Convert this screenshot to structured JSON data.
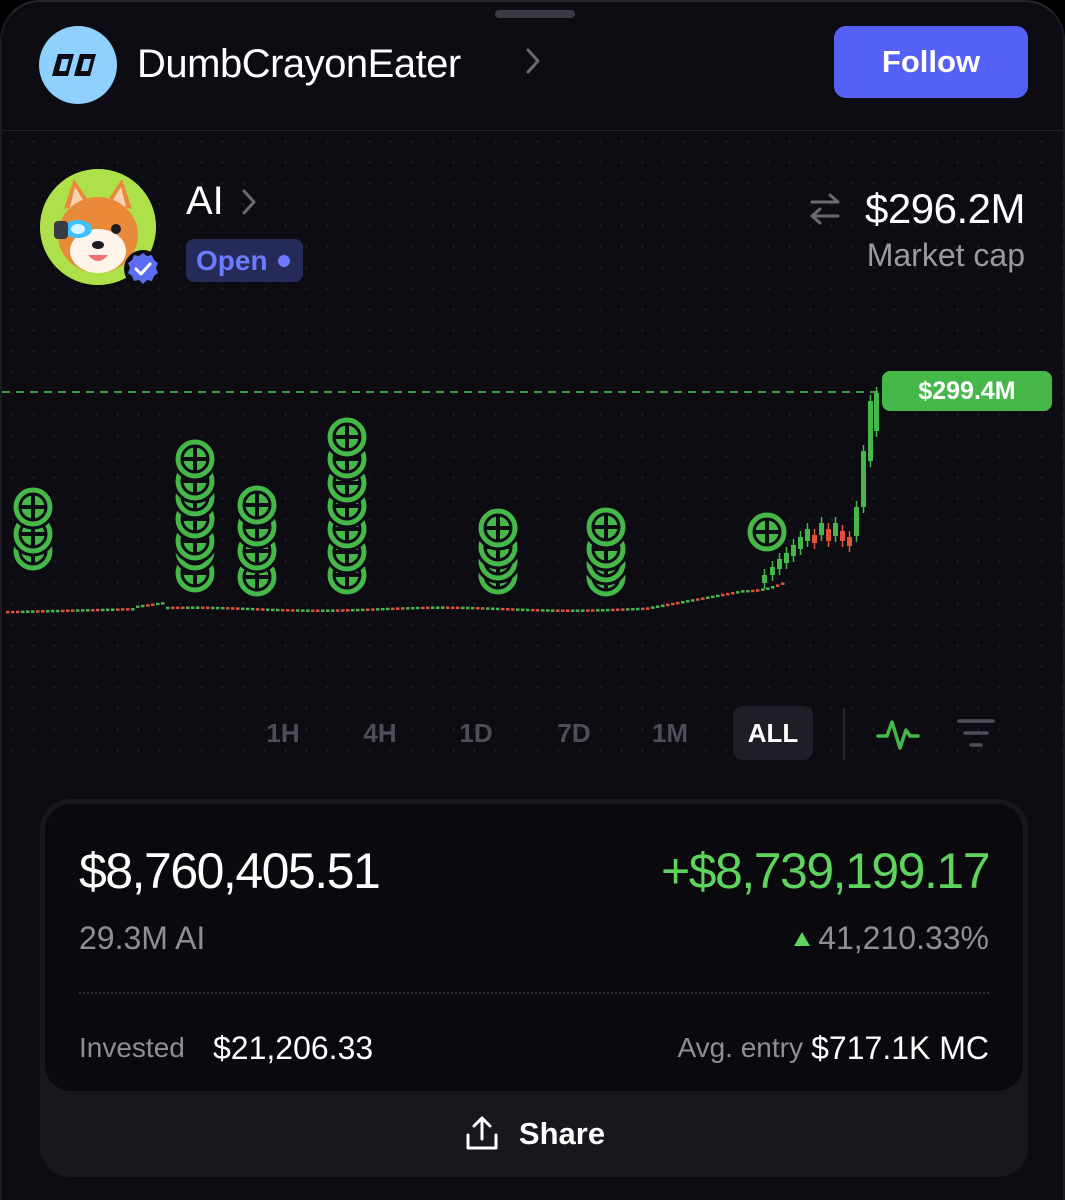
{
  "header": {
    "username": "DumbCrayonEater",
    "follow_label": "Follow"
  },
  "token": {
    "name": "AI",
    "status": "Open",
    "market_cap": "$296.2M",
    "market_cap_label": "Market cap"
  },
  "chart": {
    "current_price_label": "$299.4M",
    "timeframes": [
      "1H",
      "4H",
      "1D",
      "7D",
      "1M",
      "ALL"
    ],
    "active_timeframe": "ALL"
  },
  "position": {
    "value": "$8,760,405.51",
    "pnl": "+$8,739,199.17",
    "holding": "29.3M AI",
    "pnl_percent": "41,210.33%",
    "invested_label": "Invested",
    "invested_value": "$21,206.33",
    "avg_entry_label": "Avg. entry",
    "avg_entry_value": "$717.1K MC"
  },
  "share_label": "Share",
  "colors": {
    "accent": "#5560f6",
    "up": "#46b84a",
    "down": "#e0533a",
    "status": "#6d7bff"
  },
  "icons": [
    "logo-icon",
    "chevron-right-icon",
    "verified-icon",
    "swap-icon",
    "pulse-icon",
    "filter-icon",
    "share-icon",
    "buy-marker-icon"
  ]
}
